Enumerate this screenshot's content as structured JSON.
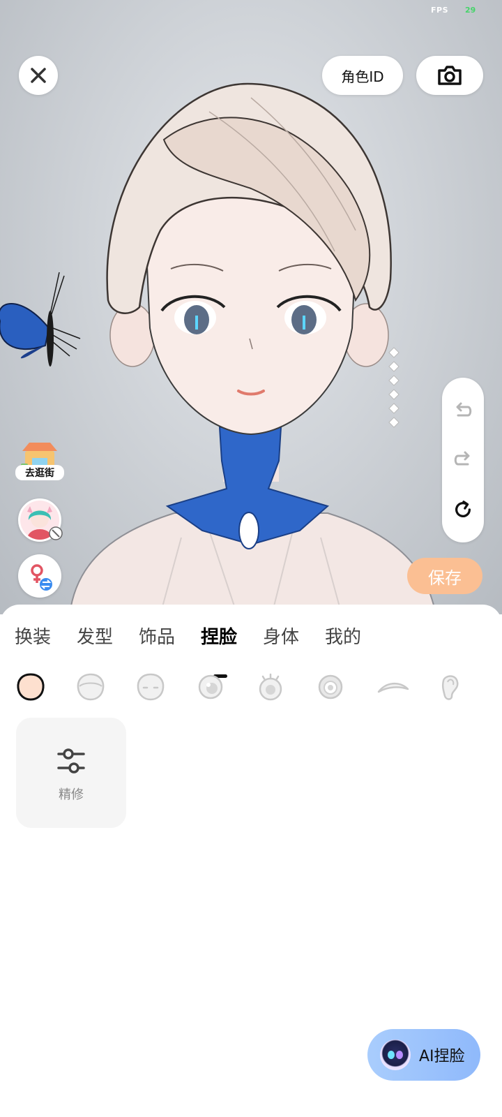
{
  "status": {
    "fps_label": "FPS",
    "fps_value": "29"
  },
  "header": {
    "role_id_label": "角色ID",
    "close_icon": "close-icon",
    "camera_icon": "camera-icon"
  },
  "sidebar": {
    "shop_label": "去逛街",
    "shop_icon": "shop-icon",
    "avatar_icon": "avatar-icon",
    "gender_icon": "gender-swap-icon"
  },
  "history": {
    "undo_icon": "undo-icon",
    "redo_icon": "redo-icon",
    "reset_icon": "reset-icon"
  },
  "save_label": "保存",
  "tabs": [
    {
      "label": "换装"
    },
    {
      "label": "发型"
    },
    {
      "label": "饰品"
    },
    {
      "label": "捏脸",
      "active": true
    },
    {
      "label": "身体"
    },
    {
      "label": "我的"
    }
  ],
  "subcategories": [
    {
      "icon": "face-shape-icon",
      "selected": true
    },
    {
      "icon": "face-icon"
    },
    {
      "icon": "face-features-icon"
    },
    {
      "icon": "eye-icon"
    },
    {
      "icon": "eyelash-icon"
    },
    {
      "icon": "pupil-icon"
    },
    {
      "icon": "eyebrow-icon"
    },
    {
      "icon": "ear-icon"
    }
  ],
  "refine": {
    "label": "精修",
    "icon": "sliders-icon"
  },
  "ai_button": {
    "label": "AI捏脸",
    "icon": "ai-robot-icon"
  },
  "colors": {
    "accent_save": "#fbbf93",
    "ai_button": "#9cc3fc",
    "active_tab": "#000000"
  }
}
